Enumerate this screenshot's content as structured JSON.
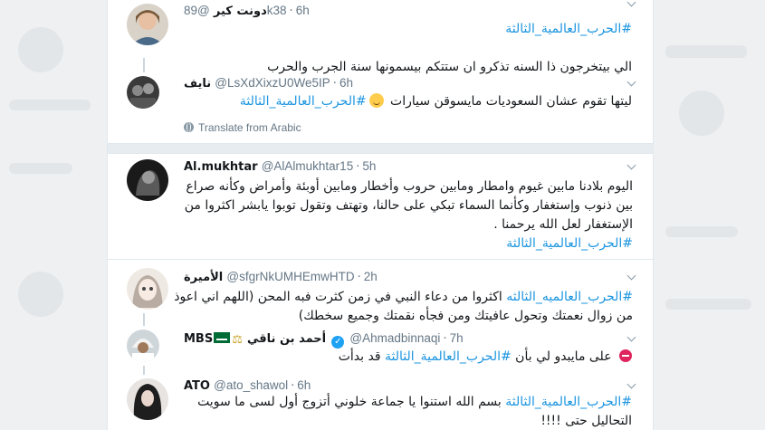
{
  "tweets": [
    {
      "name": "دونت كير",
      "handle": "@89k38",
      "time": "6h",
      "lines": [
        [
          {
            "t": "#الحرب_العالمية_الثالثة",
            "tag": true
          }
        ],
        [
          {
            "t": "",
            "tag": false
          }
        ],
        [
          {
            "t": "الي بيتخرجون ذا السنه تذكرو ان ستتكم بيسمونها سنة الجرب والحرب",
            "tag": false
          }
        ]
      ]
    },
    {
      "name": "نايف",
      "handle": "@LsXdXixzU0We5IP",
      "time": "6h",
      "lines": [
        [
          {
            "t": "ليتها تقوم عشان السعوديات مايسوقن سيارات ",
            "tag": false
          },
          {
            "t": "#الحرب_العالمية_الثالثة",
            "tag": true
          }
        ]
      ],
      "emoji": "hugging-face-emoji",
      "translate": "Translate from Arabic"
    },
    {
      "name": "Al.mukhtar",
      "handle": "@AlAlmukhtar15",
      "time": "5h",
      "lines": [
        [
          {
            "t": "اليوم بلادنا مابين غيوم وامطار ومابين حروب وأخطار ومابين أوبئة وأمراض وكأنه صراع",
            "tag": false
          }
        ],
        [
          {
            "t": "بين ذنوب وإستغفار وكأنما السماء تبكي على حالنا، وتهتف وتقول توبوا يابشر اكثروا من",
            "tag": false
          }
        ],
        [
          {
            "t": "الإستغفار لعل الله يرحمنا .",
            "tag": false
          }
        ],
        [
          {
            "t": "#الحرب_العالمية_الثالثة",
            "tag": true
          }
        ]
      ]
    },
    {
      "name": "الأميرة",
      "handle": "@sfgrNkUMHEmwHTD",
      "time": "2h",
      "lines": [
        [
          {
            "t": "#الحرب_العالميه_الثالثه",
            "tag": true
          },
          {
            "t": " اكثروا من دعاء النبي في زمن كثرت فبه المحن  (اللهم اني اعوذ",
            "tag": false
          }
        ],
        [
          {
            "t": "من زوال نعمتك وتحول عافيتك ومن فجأه نقمتك وجميع سخطك)",
            "tag": false
          }
        ]
      ]
    },
    {
      "name": "MBS",
      "name_ar": "أحمد بن ناقي",
      "handle": "@Ahmadbinnaqi",
      "time": "7h",
      "lines": [
        [
          {
            "t": " على مايبدو لي بأن ",
            "tag": false
          },
          {
            "t": "#الحرب_العالمية_الثالثة",
            "tag": true
          },
          {
            "t": " قد بدأت",
            "tag": false
          }
        ]
      ]
    },
    {
      "name": "ATO",
      "handle": "@ato_shawol",
      "time": "6h",
      "lines": [
        [
          {
            "t": "#الحرب_العالمية_الثالثة",
            "tag": true
          },
          {
            "t": " بسم الله استنوا يا جماعة خلوني أتزوج أول لسى ما سويت",
            "tag": false
          }
        ],
        [
          {
            "t": "التحاليل حتى !!!!",
            "tag": false
          }
        ]
      ]
    }
  ],
  "colors": {
    "link": "#1b95e0",
    "muted": "#657786",
    "verified": "#1da1f2"
  }
}
